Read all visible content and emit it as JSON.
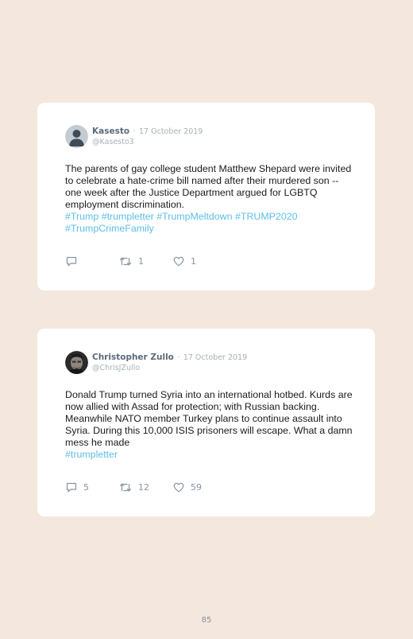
{
  "tweets": [
    {
      "author": "Kasesto",
      "separator": "·",
      "date": "17 October 2019",
      "handle": "@Kasesto3",
      "avatar": "default-person",
      "text": "The parents of gay college student Matthew Shepard were invited to celebrate a hate-crime bill named after their murdered son -- one week after the Justice Department argued for LGBTQ employment discrimination.",
      "hashtags": [
        "#Trump",
        "#trumpletter",
        "#TrumpMeltdown",
        "#TRUMP2020",
        "#TrumpCrimeFamily"
      ],
      "replies": "",
      "retweets": "1",
      "likes": "1"
    },
    {
      "author": "Christopher Zullo",
      "separator": "·",
      "date": "17 October 2019",
      "handle": "@ChrisJZullo",
      "avatar": "photo",
      "text": "Donald Trump turned Syria into an international hotbed. Kurds are now allied with Assad for protection; with Russian backing. Meanwhile NATO member Turkey plans to continue assault into Syria. During this 10,000 ISIS prisoners will escape. What a damn mess he made",
      "hashtags": [
        "#trumpletter"
      ],
      "replies": "5",
      "retweets": "12",
      "likes": "59"
    }
  ],
  "icons": {
    "reply": "reply-icon",
    "retweet": "retweet-icon",
    "like": "like-icon"
  },
  "colors": {
    "page_background": "#f4e8de",
    "card_background": "#ffffff",
    "hashtag": "#5bbfe8",
    "muted": "#a7b0b9"
  },
  "page_number": "85"
}
